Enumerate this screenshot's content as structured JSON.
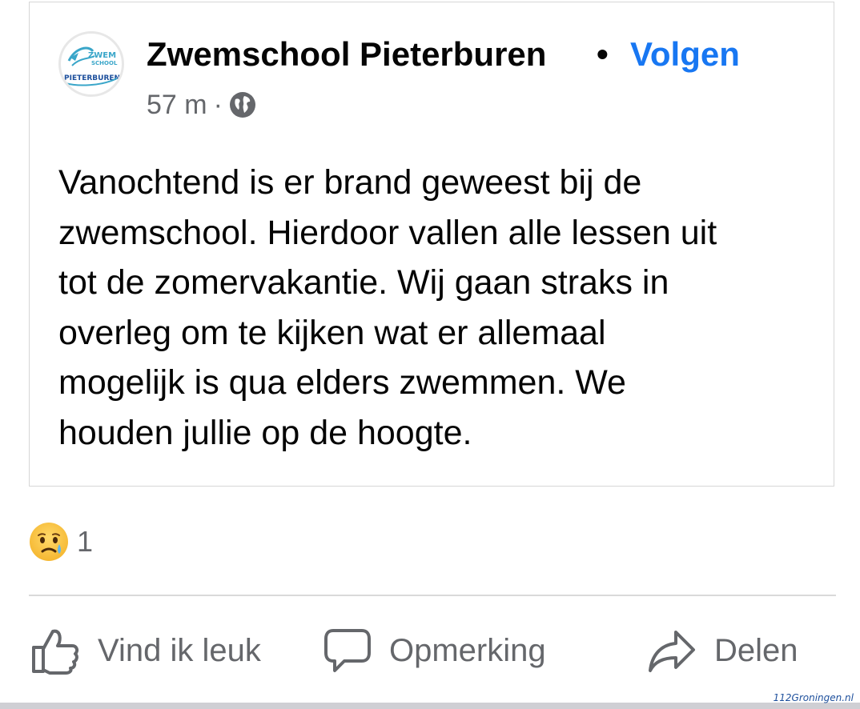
{
  "post": {
    "author": "Zwemschool Pieterburen",
    "separator": "•",
    "follow_label": "Volgen",
    "time": "57 m",
    "meta_dot": "·",
    "audience_icon": "globe-icon",
    "text_lines": [
      "Vanochtend is er brand geweest bij de",
      "zwemschool. Hierdoor vallen alle lessen uit",
      "tot de zomervakantie. Wij gaan straks in",
      "overleg om te kijken wat er allemaal",
      "mogelijk is qua elders zwemmen. We",
      "houden jullie op de hoogte."
    ]
  },
  "logo": {
    "line1": "ZWEM",
    "line2": "SCHOOL",
    "line3": "PIETERBUREN"
  },
  "reactions": {
    "icon": "sad-face-icon",
    "count": "1"
  },
  "actions": {
    "like_label": "Vind ik leuk",
    "comment_label": "Opmerking",
    "share_label": "Delen"
  },
  "watermark": "112Groningen.nl",
  "colors": {
    "accent": "#1877f2",
    "secondary_text": "#65676b",
    "logo_teal": "#3aa6c9",
    "logo_blue": "#1d4f9c"
  }
}
